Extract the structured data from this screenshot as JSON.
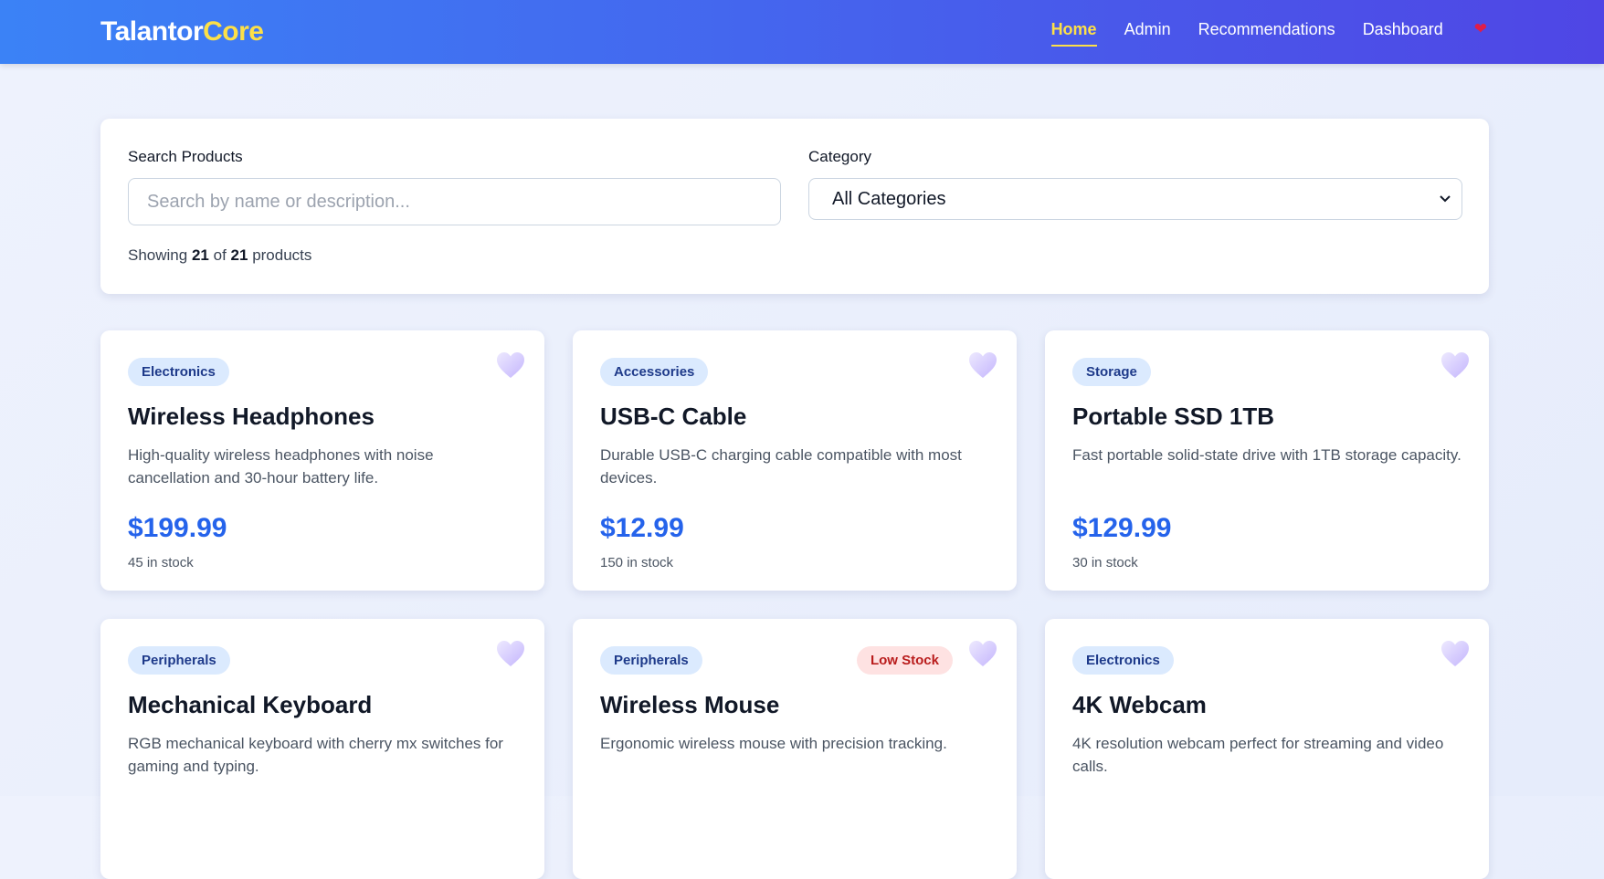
{
  "brand": {
    "name_part1": "Talantor",
    "name_part2": "Core"
  },
  "nav": {
    "links": [
      {
        "label": "Home",
        "active": true
      },
      {
        "label": "Admin",
        "active": false
      },
      {
        "label": "Recommendations",
        "active": false
      },
      {
        "label": "Dashboard",
        "active": false
      }
    ],
    "favorites_icon": "heart-icon"
  },
  "filters": {
    "search_label": "Search Products",
    "search_placeholder": "Search by name or description...",
    "search_value": "",
    "category_label": "Category",
    "category_value": "All Categories",
    "results": {
      "prefix": "Showing",
      "shown": "21",
      "middle": "of",
      "total": "21",
      "suffix": "products"
    }
  },
  "colors": {
    "nav_gradient_start": "#3b82f6",
    "nav_gradient_end": "#4f46e5",
    "brand_accent": "#fde047",
    "price": "#2563eb",
    "badge_bg": "#dbeafe",
    "low_stock_bg": "#fee2e2",
    "low_stock_text": "#b91c1c"
  },
  "products": [
    {
      "category": "Electronics",
      "name": "Wireless Headphones",
      "description": "High-quality wireless headphones with noise cancellation and 30-hour battery life.",
      "price": "$199.99",
      "stock": "45 in stock",
      "low_stock": ""
    },
    {
      "category": "Accessories",
      "name": "USB-C Cable",
      "description": "Durable USB-C charging cable compatible with most devices.",
      "price": "$12.99",
      "stock": "150 in stock",
      "low_stock": ""
    },
    {
      "category": "Storage",
      "name": "Portable SSD 1TB",
      "description": "Fast portable solid-state drive with 1TB storage capacity.",
      "price": "$129.99",
      "stock": "30 in stock",
      "low_stock": ""
    },
    {
      "category": "Peripherals",
      "name": "Mechanical Keyboard",
      "description": "RGB mechanical keyboard with cherry mx switches for gaming and typing.",
      "price": "",
      "stock": "",
      "low_stock": ""
    },
    {
      "category": "Peripherals",
      "name": "Wireless Mouse",
      "description": "Ergonomic wireless mouse with precision tracking.",
      "price": "",
      "stock": "",
      "low_stock": "Low Stock"
    },
    {
      "category": "Electronics",
      "name": "4K Webcam",
      "description": "4K resolution webcam perfect for streaming and video calls.",
      "price": "",
      "stock": "",
      "low_stock": ""
    }
  ]
}
